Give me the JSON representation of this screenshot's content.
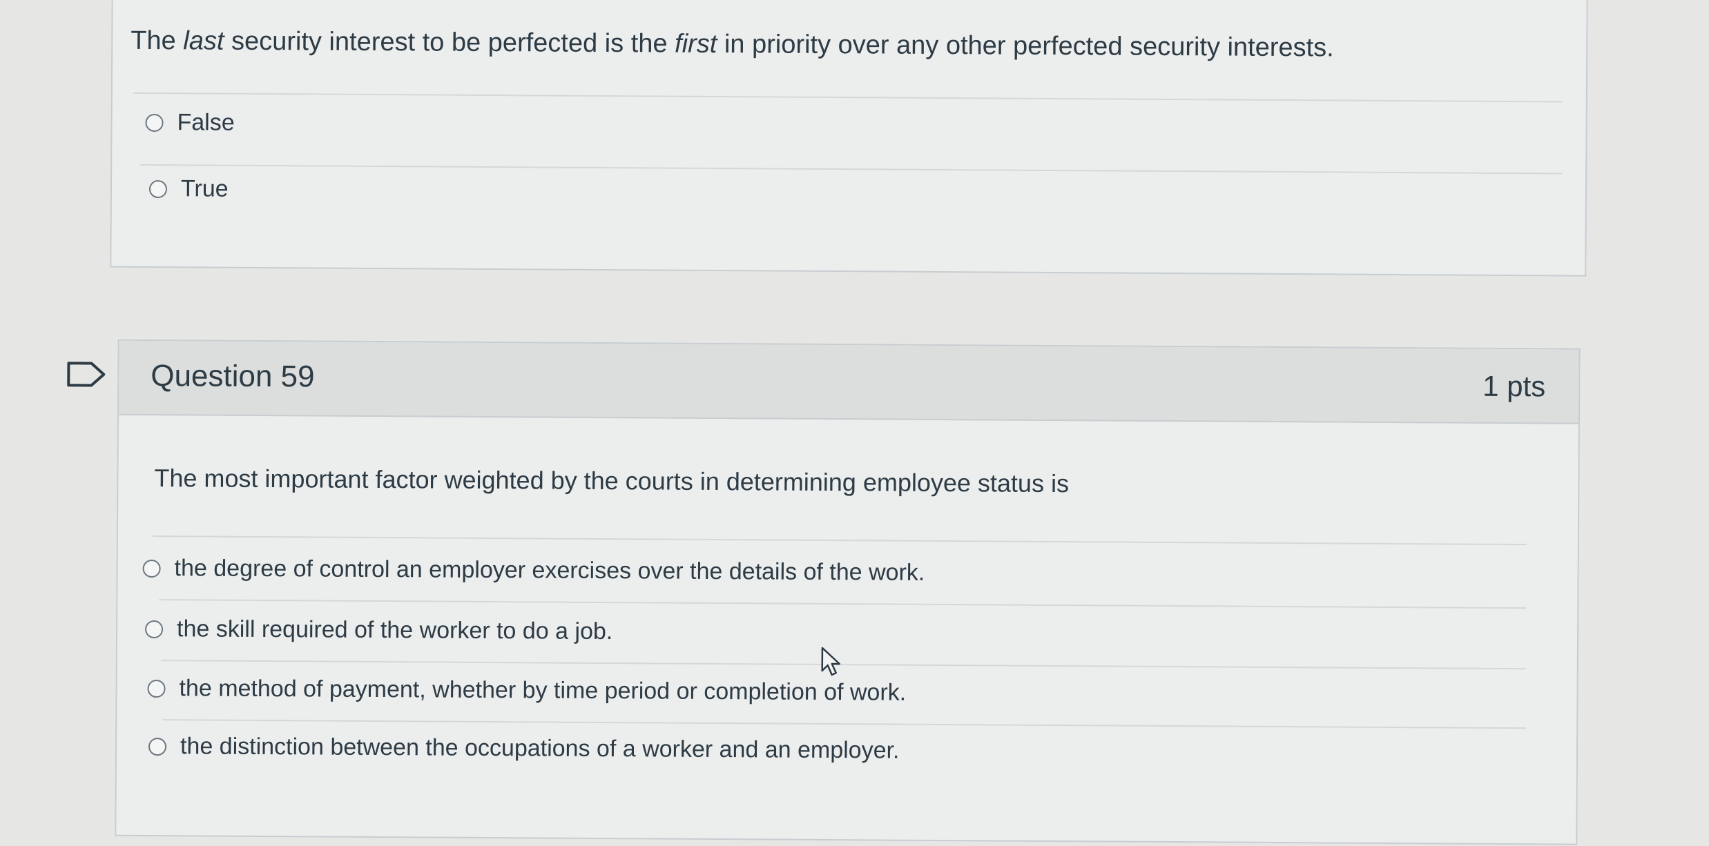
{
  "previous_question": {
    "text_before": "The ",
    "text_em1": "last",
    "text_middle": " security interest to be perfected is the ",
    "text_em2": "first",
    "text_after": " in priority over any other perfected security interests.",
    "options": [
      {
        "label": "False"
      },
      {
        "label": "True"
      }
    ]
  },
  "question": {
    "title": "Question 59",
    "points": "1 pts",
    "text": "The most important factor weighted by the courts in determining employee status is",
    "options": [
      {
        "label": "the degree of control an employer exercises over the details of the work."
      },
      {
        "label": "the skill required of the worker to do a job."
      },
      {
        "label": "the method of payment, whether by time period or completion of work."
      },
      {
        "label": "the distinction between the occupations of a worker and an employer."
      }
    ]
  },
  "icons": {
    "flag": "flag-outline-icon",
    "cursor": "mouse-pointer-icon"
  },
  "colors": {
    "background": "#e6e7e5",
    "card": "#eceded",
    "header": "#dcdedd",
    "border": "#c7cdd1",
    "text": "#2d3b45"
  }
}
